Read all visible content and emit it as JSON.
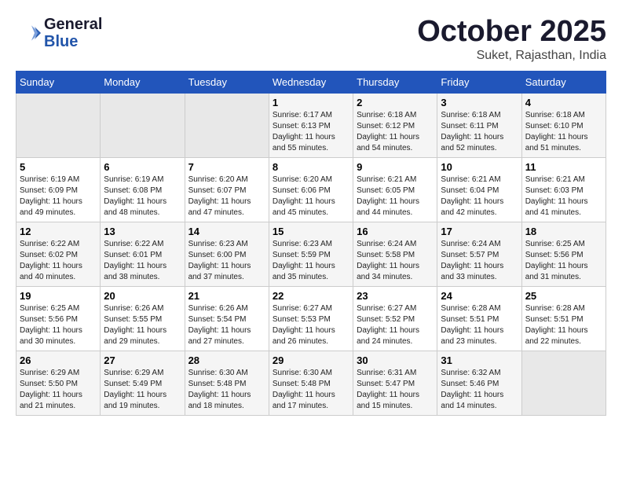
{
  "header": {
    "logo_line1": "General",
    "logo_line2": "Blue",
    "month": "October 2025",
    "location": "Suket, Rajasthan, India"
  },
  "weekdays": [
    "Sunday",
    "Monday",
    "Tuesday",
    "Wednesday",
    "Thursday",
    "Friday",
    "Saturday"
  ],
  "weeks": [
    [
      {
        "day": "",
        "info": ""
      },
      {
        "day": "",
        "info": ""
      },
      {
        "day": "",
        "info": ""
      },
      {
        "day": "1",
        "info": "Sunrise: 6:17 AM\nSunset: 6:13 PM\nDaylight: 11 hours and 55 minutes."
      },
      {
        "day": "2",
        "info": "Sunrise: 6:18 AM\nSunset: 6:12 PM\nDaylight: 11 hours and 54 minutes."
      },
      {
        "day": "3",
        "info": "Sunrise: 6:18 AM\nSunset: 6:11 PM\nDaylight: 11 hours and 52 minutes."
      },
      {
        "day": "4",
        "info": "Sunrise: 6:18 AM\nSunset: 6:10 PM\nDaylight: 11 hours and 51 minutes."
      }
    ],
    [
      {
        "day": "5",
        "info": "Sunrise: 6:19 AM\nSunset: 6:09 PM\nDaylight: 11 hours and 49 minutes."
      },
      {
        "day": "6",
        "info": "Sunrise: 6:19 AM\nSunset: 6:08 PM\nDaylight: 11 hours and 48 minutes."
      },
      {
        "day": "7",
        "info": "Sunrise: 6:20 AM\nSunset: 6:07 PM\nDaylight: 11 hours and 47 minutes."
      },
      {
        "day": "8",
        "info": "Sunrise: 6:20 AM\nSunset: 6:06 PM\nDaylight: 11 hours and 45 minutes."
      },
      {
        "day": "9",
        "info": "Sunrise: 6:21 AM\nSunset: 6:05 PM\nDaylight: 11 hours and 44 minutes."
      },
      {
        "day": "10",
        "info": "Sunrise: 6:21 AM\nSunset: 6:04 PM\nDaylight: 11 hours and 42 minutes."
      },
      {
        "day": "11",
        "info": "Sunrise: 6:21 AM\nSunset: 6:03 PM\nDaylight: 11 hours and 41 minutes."
      }
    ],
    [
      {
        "day": "12",
        "info": "Sunrise: 6:22 AM\nSunset: 6:02 PM\nDaylight: 11 hours and 40 minutes."
      },
      {
        "day": "13",
        "info": "Sunrise: 6:22 AM\nSunset: 6:01 PM\nDaylight: 11 hours and 38 minutes."
      },
      {
        "day": "14",
        "info": "Sunrise: 6:23 AM\nSunset: 6:00 PM\nDaylight: 11 hours and 37 minutes."
      },
      {
        "day": "15",
        "info": "Sunrise: 6:23 AM\nSunset: 5:59 PM\nDaylight: 11 hours and 35 minutes."
      },
      {
        "day": "16",
        "info": "Sunrise: 6:24 AM\nSunset: 5:58 PM\nDaylight: 11 hours and 34 minutes."
      },
      {
        "day": "17",
        "info": "Sunrise: 6:24 AM\nSunset: 5:57 PM\nDaylight: 11 hours and 33 minutes."
      },
      {
        "day": "18",
        "info": "Sunrise: 6:25 AM\nSunset: 5:56 PM\nDaylight: 11 hours and 31 minutes."
      }
    ],
    [
      {
        "day": "19",
        "info": "Sunrise: 6:25 AM\nSunset: 5:56 PM\nDaylight: 11 hours and 30 minutes."
      },
      {
        "day": "20",
        "info": "Sunrise: 6:26 AM\nSunset: 5:55 PM\nDaylight: 11 hours and 29 minutes."
      },
      {
        "day": "21",
        "info": "Sunrise: 6:26 AM\nSunset: 5:54 PM\nDaylight: 11 hours and 27 minutes."
      },
      {
        "day": "22",
        "info": "Sunrise: 6:27 AM\nSunset: 5:53 PM\nDaylight: 11 hours and 26 minutes."
      },
      {
        "day": "23",
        "info": "Sunrise: 6:27 AM\nSunset: 5:52 PM\nDaylight: 11 hours and 24 minutes."
      },
      {
        "day": "24",
        "info": "Sunrise: 6:28 AM\nSunset: 5:51 PM\nDaylight: 11 hours and 23 minutes."
      },
      {
        "day": "25",
        "info": "Sunrise: 6:28 AM\nSunset: 5:51 PM\nDaylight: 11 hours and 22 minutes."
      }
    ],
    [
      {
        "day": "26",
        "info": "Sunrise: 6:29 AM\nSunset: 5:50 PM\nDaylight: 11 hours and 21 minutes."
      },
      {
        "day": "27",
        "info": "Sunrise: 6:29 AM\nSunset: 5:49 PM\nDaylight: 11 hours and 19 minutes."
      },
      {
        "day": "28",
        "info": "Sunrise: 6:30 AM\nSunset: 5:48 PM\nDaylight: 11 hours and 18 minutes."
      },
      {
        "day": "29",
        "info": "Sunrise: 6:30 AM\nSunset: 5:48 PM\nDaylight: 11 hours and 17 minutes."
      },
      {
        "day": "30",
        "info": "Sunrise: 6:31 AM\nSunset: 5:47 PM\nDaylight: 11 hours and 15 minutes."
      },
      {
        "day": "31",
        "info": "Sunrise: 6:32 AM\nSunset: 5:46 PM\nDaylight: 11 hours and 14 minutes."
      },
      {
        "day": "",
        "info": ""
      }
    ]
  ]
}
